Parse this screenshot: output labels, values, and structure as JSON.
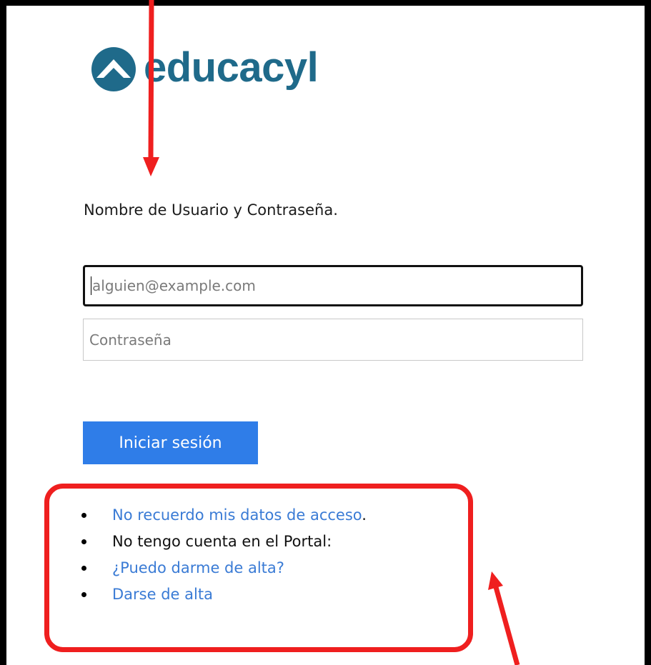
{
  "logo": {
    "brand_text": "educacyl",
    "brand_color": "#1f6a8a",
    "icon": "educacyl-logo-icon"
  },
  "login": {
    "instruction": "Nombre de Usuario y Contraseña.",
    "email_placeholder": "alguien@example.com",
    "password_placeholder": "Contraseña",
    "signin_label": "Iniciar sesión",
    "signin_color": "#2f7de8"
  },
  "links": {
    "items": [
      {
        "label": "No recuerdo mis datos de acceso",
        "suffix": ".",
        "is_link": true
      },
      {
        "label": "No tengo cuenta en el Portal:",
        "suffix": "",
        "is_link": false
      },
      {
        "label": "¿Puedo darme de alta?",
        "suffix": "",
        "is_link": true
      },
      {
        "label": "Darse de alta",
        "suffix": "",
        "is_link": true
      }
    ],
    "link_color": "#3a7bd5"
  },
  "annotations": {
    "highlight_color": "#ef1f1f",
    "arrows": [
      "arrow-down-to-instruction",
      "arrow-up-to-links"
    ]
  }
}
